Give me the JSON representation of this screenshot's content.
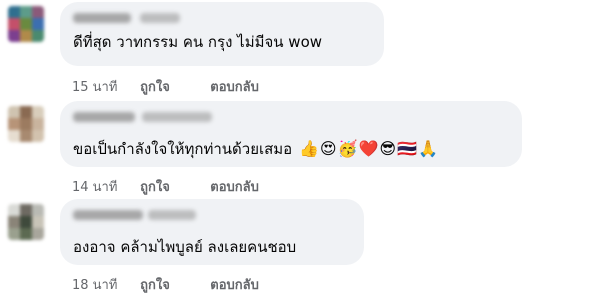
{
  "comments": [
    {
      "text": "ดีที่สุด วาทกรรม คน กรุง ไม่มีจน wow",
      "emoji": "",
      "time": "15 นาที",
      "like_label": "ถูกใจ",
      "reply_label": "ตอบกลับ"
    },
    {
      "text": "ขอเป็นกำลังใจให้ทุกท่านด้วยเสมอ",
      "emoji": "👍😍🥳❤️😎🇹🇭🙏",
      "time": "14 นาที",
      "like_label": "ถูกใจ",
      "reply_label": "ตอบกลับ"
    },
    {
      "text": "องอาจ คล้ามไพบูลย์ ลงเลยคนชอบ",
      "emoji": "",
      "time": "18 นาที",
      "like_label": "ถูกใจ",
      "reply_label": "ตอบกลับ"
    }
  ],
  "colors": {
    "bubble": "#f0f2f5",
    "meta_text": "#65676b",
    "body_text": "#050505"
  }
}
